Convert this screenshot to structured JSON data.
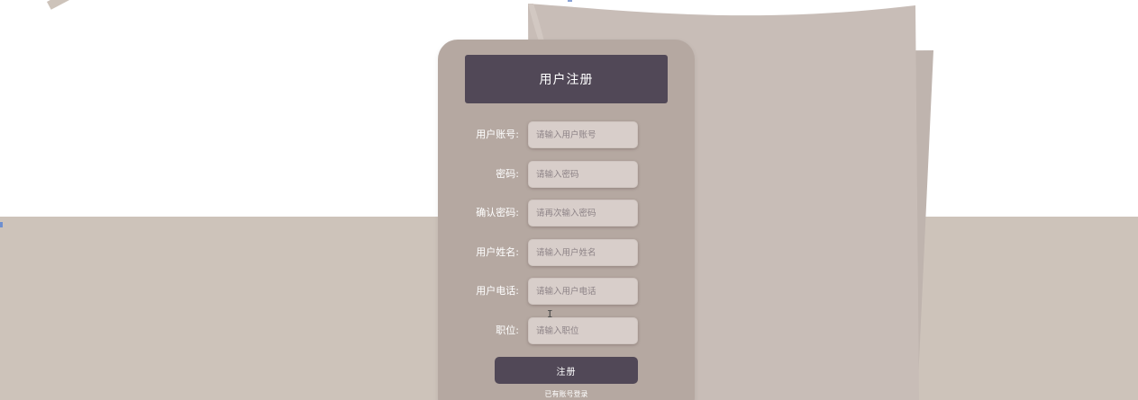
{
  "form": {
    "title": "用户注册",
    "fields": [
      {
        "label": "用户账号:",
        "placeholder": "请输入用户账号",
        "value": ""
      },
      {
        "label": "密码:",
        "placeholder": "请输入密码",
        "value": ""
      },
      {
        "label": "确认密码:",
        "placeholder": "请再次输入密码",
        "value": ""
      },
      {
        "label": "用户姓名:",
        "placeholder": "请输入用户姓名",
        "value": ""
      },
      {
        "label": "用户电话:",
        "placeholder": "请输入用户电话",
        "value": ""
      },
      {
        "label": "职位:",
        "placeholder": "请输入职位",
        "value": ""
      }
    ],
    "submit_label": "注册",
    "login_link": "已有账号登录"
  },
  "colors": {
    "card": "#b5a8a1",
    "title_bar": "#514857",
    "input_bg": "#d8ceca",
    "floor": "#cdc3ba",
    "paper": "#c8bdb7"
  },
  "icons": {
    "cursor": "i-beam-cursor-icon"
  }
}
